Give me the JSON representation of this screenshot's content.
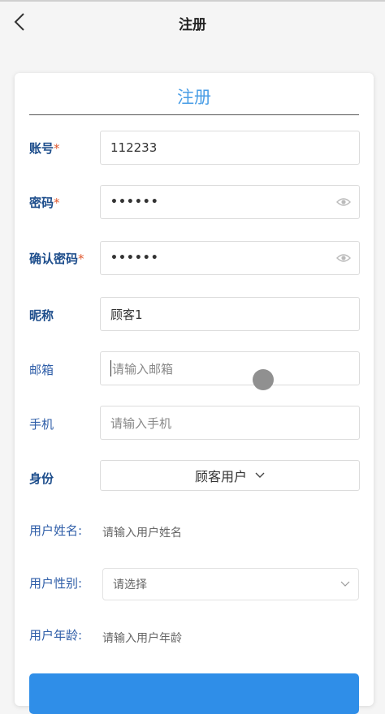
{
  "header": {
    "title": "注册",
    "back_glyph": "back-chevron-icon"
  },
  "card": {
    "title": "注册"
  },
  "fields": {
    "account": {
      "label": "账号",
      "required": "*",
      "value": "112233"
    },
    "password": {
      "label": "密码",
      "required": "*",
      "value": "••••••"
    },
    "confirm": {
      "label": "确认密码",
      "required": "*",
      "value": "••••••"
    },
    "nickname": {
      "label": "昵称",
      "value": "顾客1"
    },
    "email": {
      "label": "邮箱",
      "placeholder": "请输入邮箱"
    },
    "phone": {
      "label": "手机",
      "placeholder": "请输入手机"
    },
    "identity": {
      "label": "身份",
      "value": "顾客用户"
    },
    "username": {
      "label": "用户姓名:",
      "placeholder": "请输入用户姓名"
    },
    "gender": {
      "label": "用户性别:",
      "placeholder": "请选择"
    },
    "age": {
      "label": "用户年龄:",
      "placeholder": "请输入用户年龄"
    }
  },
  "colors": {
    "accent": "#4a9ee6",
    "label": "#1e4e8c",
    "required": "#e0582e",
    "button": "#2f8ee8"
  }
}
